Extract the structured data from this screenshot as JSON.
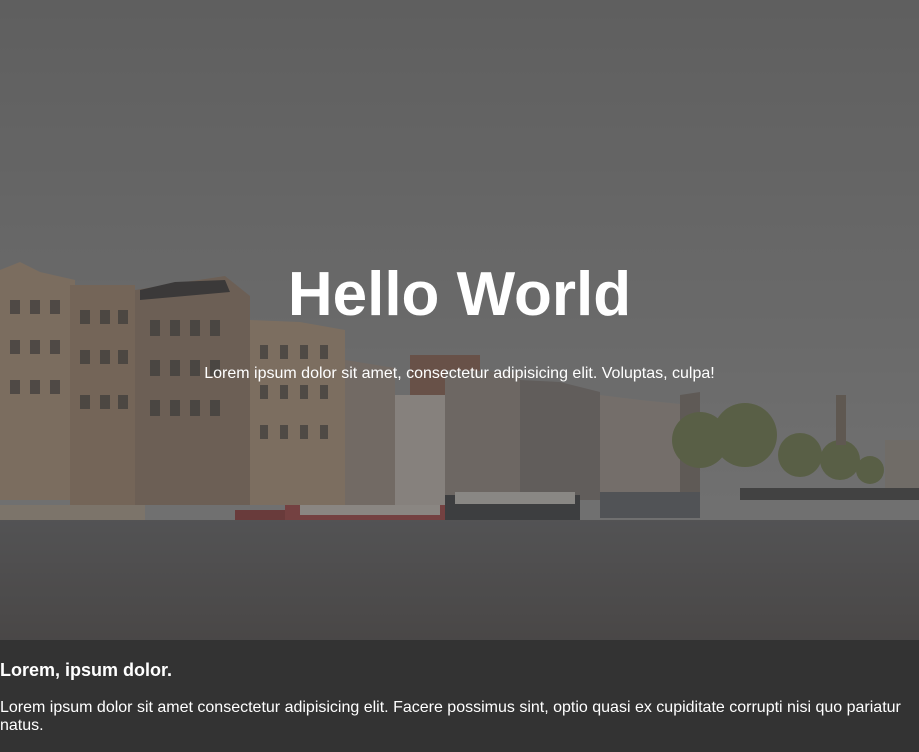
{
  "hero": {
    "title": "Hello World",
    "subtitle": "Lorem ipsum dolor sit amet, consectetur adipisicing elit. Voluptas, culpa!"
  },
  "info": {
    "heading": "Lorem, ipsum dolor.",
    "text": "Lorem ipsum dolor sit amet consectetur adipisicing elit. Facere possimus sint, optio quasi ex cupiditate corrupti nisi quo pariatur natus."
  },
  "colors": {
    "overlay": "#3c3c3c",
    "footer_bg": "#333333",
    "text": "#ffffff"
  }
}
